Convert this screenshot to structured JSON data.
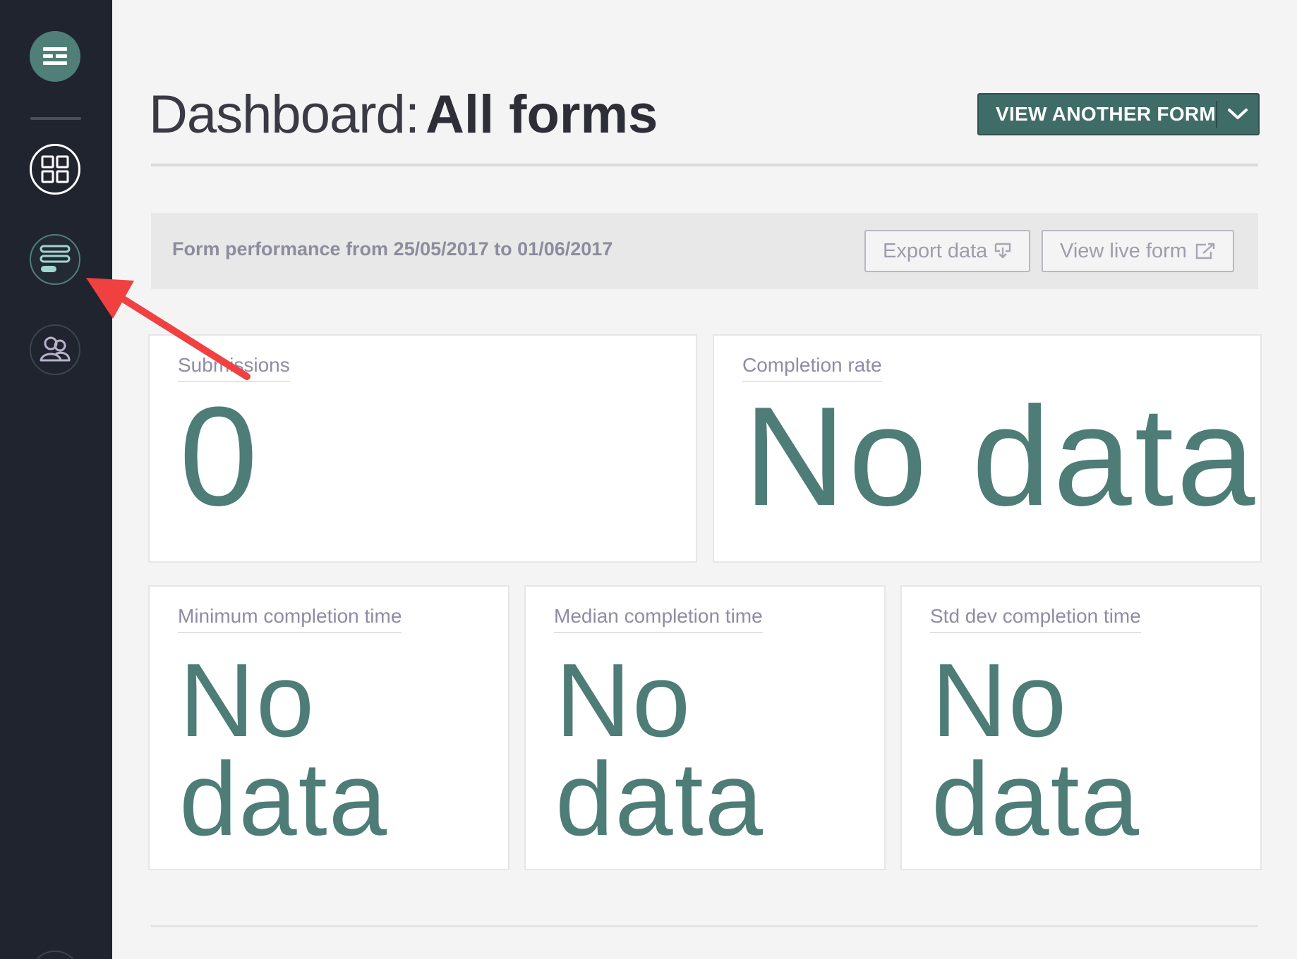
{
  "header": {
    "title_prefix": "Dashboard",
    "title_colon": ":",
    "title_strong": "All forms",
    "view_another_label": "VIEW ANOTHER FORM"
  },
  "performance": {
    "text": "Form performance from 25/05/2017 to 01/06/2017",
    "export_label": "Export data",
    "live_label": "View live form"
  },
  "cards": {
    "submissions": {
      "label": "Submissions",
      "value": "0"
    },
    "completion_rate": {
      "label": "Completion rate",
      "value": "No data"
    },
    "min_time": {
      "label": "Minimum completion time",
      "value": "No data"
    },
    "median_time": {
      "label": "Median completion time",
      "value": "No data"
    },
    "stddev_time": {
      "label": "Std dev completion time",
      "value": "No data"
    }
  },
  "sidebar": {
    "items": [
      {
        "name": "menu",
        "icon": "menu-icon"
      },
      {
        "name": "dashboard",
        "icon": "grid-icon"
      },
      {
        "name": "forms",
        "icon": "form-icon"
      },
      {
        "name": "users",
        "icon": "users-icon"
      }
    ]
  },
  "colors": {
    "sidebar_bg": "#20242f",
    "accent": "#4f7f77",
    "metric_text": "#4e7c76",
    "annotation_arrow": "#f04040"
  }
}
